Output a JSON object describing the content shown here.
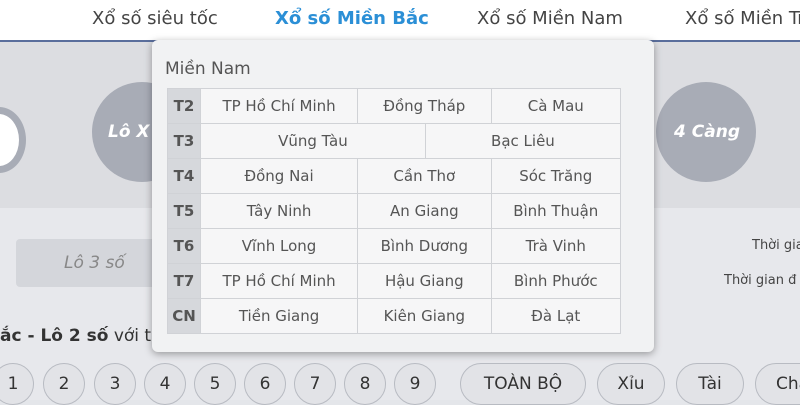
{
  "nav": {
    "items": [
      {
        "label": "Xổ số siêu tốc",
        "active": false
      },
      {
        "label": "Xổ số Miền Bắc",
        "active": true
      },
      {
        "label": "Xổ số Miền Nam",
        "active": false
      },
      {
        "label": "Xổ số Miền Tr",
        "active": false
      }
    ]
  },
  "hero": {
    "circle_left_label": "Lô X",
    "circle_right_label": "4 Càng"
  },
  "lower": {
    "tab_label": "Lô 3 số",
    "time_label_1": "Thời gia",
    "time_label_2": "Thời gian đ",
    "bet_title_bold": "ắc - Lô 2 số",
    "bet_title_rest": " với t",
    "numbers": [
      "1",
      "2",
      "3",
      "4",
      "5",
      "6",
      "7",
      "8",
      "9"
    ],
    "options": [
      "TOÀN BỘ",
      "Xỉu",
      "Tài",
      "Cha"
    ]
  },
  "popup": {
    "title": "Miền Nam",
    "rows": [
      {
        "day": "T2",
        "cells": [
          "TP Hồ Chí Minh",
          "Đồng Tháp",
          "Cà Mau"
        ]
      },
      {
        "day": "T3",
        "cells": [
          "Vũng Tàu",
          "Bạc Liêu"
        ]
      },
      {
        "day": "T4",
        "cells": [
          "Đồng Nai",
          "Cần Thơ",
          "Sóc Trăng"
        ]
      },
      {
        "day": "T5",
        "cells": [
          "Tây Ninh",
          "An Giang",
          "Bình Thuận"
        ]
      },
      {
        "day": "T6",
        "cells": [
          "Vĩnh Long",
          "Bình Dương",
          "Trà Vinh"
        ]
      },
      {
        "day": "T7",
        "cells": [
          "TP Hồ Chí Minh",
          "Hậu Giang",
          "Bình Phước"
        ]
      },
      {
        "day": "CN",
        "cells": [
          "Tiền Giang",
          "Kiên Giang",
          "Đà Lạt"
        ]
      }
    ]
  }
}
